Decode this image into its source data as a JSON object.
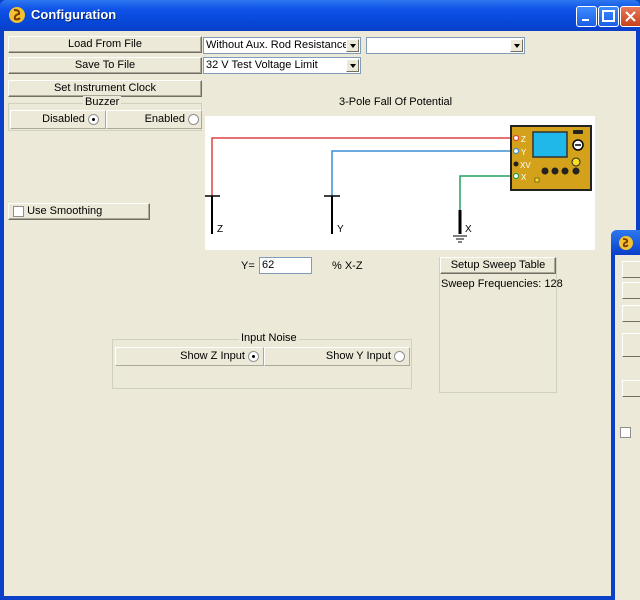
{
  "window": {
    "title": "Configuration"
  },
  "left_panel": {
    "load_label": "Load From File",
    "save_label": "Save To File",
    "set_clock_label": "Set Instrument Clock",
    "buzzer": {
      "label": "Buzzer",
      "disabled_label": "Disabled",
      "enabled_label": "Enabled",
      "selected": "Disabled"
    },
    "use_smoothing_label": "Use Smoothing",
    "use_smoothing_checked": false
  },
  "combos": {
    "resistance": "Without Aux. Rod Resistance",
    "secondary": "",
    "voltage": "32 V Test Voltage Limit"
  },
  "diagram": {
    "title": "3-Pole Fall Of Potential",
    "stake_z": "Z",
    "stake_y": "Y",
    "stake_x": "X",
    "terminal_z": "Z",
    "terminal_y": "Y",
    "terminal_xv": "XV",
    "terminal_x": "X",
    "colors": {
      "z_wire": "#e04040",
      "y_wire": "#3a8ed6",
      "x_wire": "#22a05a",
      "device_body": "#d4a21a",
      "device_screen": "#20b8e8"
    }
  },
  "y_field": {
    "prefix": "Y=",
    "value": "62",
    "unit": "% X-Z"
  },
  "sweep": {
    "setup_label": "Setup Sweep Table",
    "frequencies_text": "Sweep Frequencies: 128"
  },
  "input_noise": {
    "label": "Input Noise",
    "show_z_label": "Show Z Input",
    "show_y_label": "Show Y Input",
    "selected": "Show Z Input"
  }
}
